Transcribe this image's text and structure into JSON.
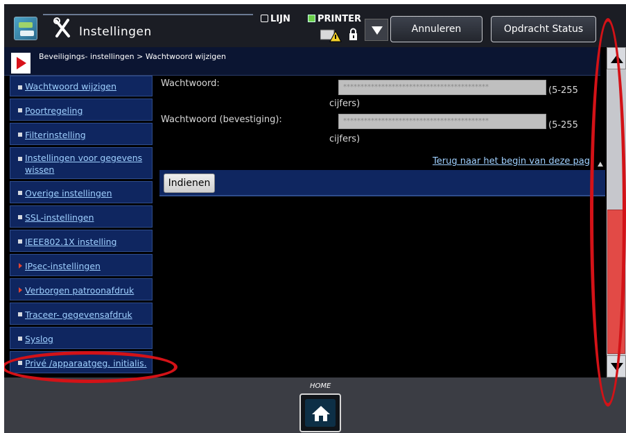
{
  "header": {
    "title": "Instellingen",
    "lijn_label": "LIJN",
    "printer_label": "PRINTER",
    "cancel_label": "Annuleren",
    "status_label": "Opdracht Status"
  },
  "breadcrumb": "Beveiligings- instellingen > Wachtwoord wijzigen",
  "sidebar": {
    "items": [
      {
        "label": "Wachtwoord wijzigen",
        "bullet": "square"
      },
      {
        "label": "Poortregeling",
        "bullet": "square"
      },
      {
        "label": "Filterinstelling",
        "bullet": "square"
      },
      {
        "label": "Instellingen voor gegevens wissen",
        "bullet": "square"
      },
      {
        "label": "Overige instellingen",
        "bullet": "square"
      },
      {
        "label": "SSL-instellingen",
        "bullet": "square"
      },
      {
        "label": "IEEE802.1X instelling",
        "bullet": "square"
      },
      {
        "label": "IPsec-instellingen",
        "bullet": "triangle"
      },
      {
        "label": "Verborgen patroonafdruk",
        "bullet": "triangle"
      },
      {
        "label": "Traceer- gegevensafdruk",
        "bullet": "square"
      },
      {
        "label": "Syslog",
        "bullet": "square"
      },
      {
        "label": "Privé /apparaatgeg. initialis.",
        "bullet": "square"
      }
    ]
  },
  "form": {
    "password_label": "Wachtwoord:",
    "password_value": "******************************************",
    "password_hint": "(5-255",
    "password_hint_unit": "cijfers)",
    "confirm_label": "Wachtwoord (bevestiging):",
    "confirm_value": "******************************************",
    "confirm_hint": "(5-255",
    "confirm_hint_unit": "cijfers)",
    "back_to_top": "Terug naar het begin van deze pagina",
    "submit_label": "Indienen"
  },
  "footer": {
    "home_label": "HOME"
  },
  "colors": {
    "accent": "#d31217",
    "nav_bg": "#0f2660",
    "link": "#9fd0ff",
    "scroll_thumb": "#e24a46"
  }
}
